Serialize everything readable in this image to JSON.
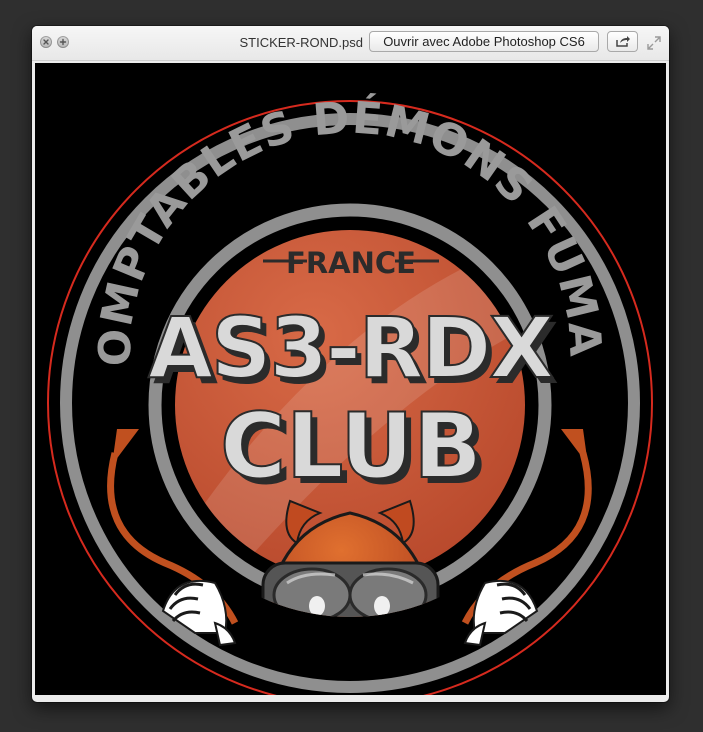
{
  "window": {
    "filename": "STICKER-ROND.psd",
    "open_button_label": "Ouvrir avec Adobe Photoshop CS6"
  },
  "icons": {
    "close": "close-icon",
    "zoom": "zoom-icon",
    "share": "share-icon",
    "fullscreen": "fullscreen-icon"
  },
  "sticker": {
    "arc_text": "INDOMPTABLES DÉMONS FUMANTS",
    "country": "FRANCE",
    "line1": "AS3-RDX",
    "line2": "CLUB",
    "colors": {
      "background": "#000000",
      "outer_ring": "#d62a1e",
      "grey_ring": "#8e8e8e",
      "disc": "#c85a3a",
      "text": "#d9d9d9"
    }
  }
}
